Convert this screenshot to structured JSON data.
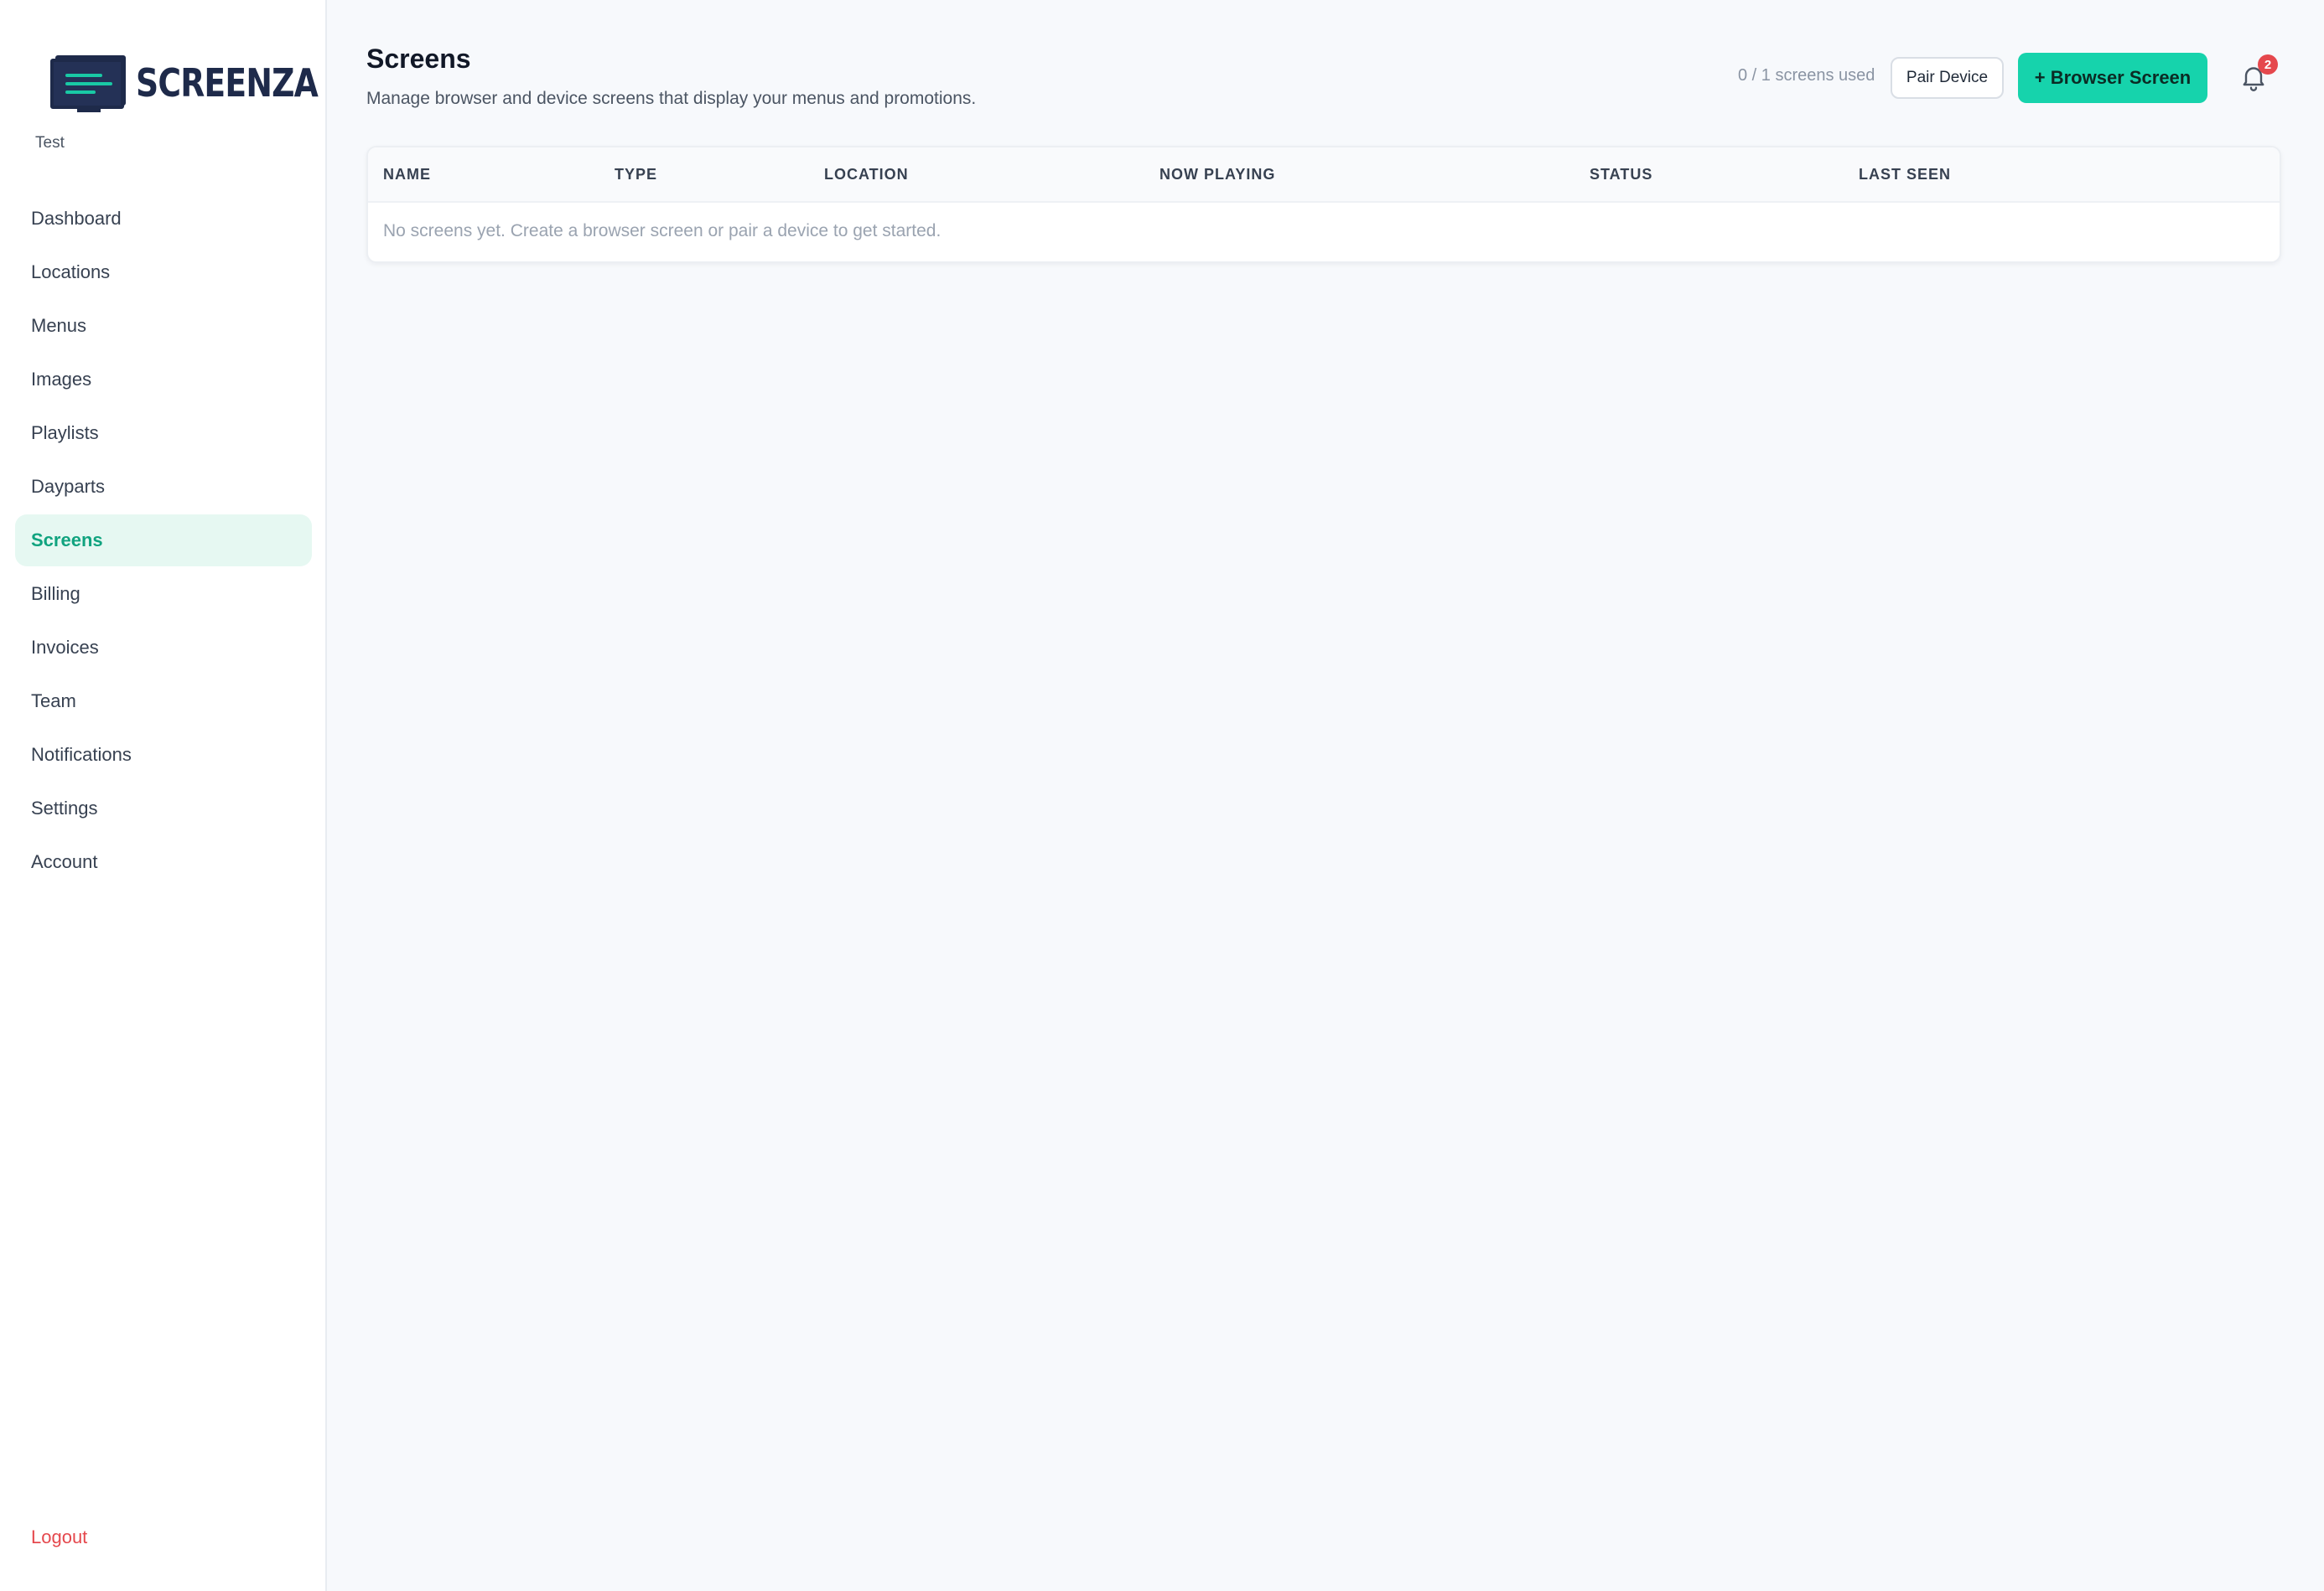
{
  "brand": {
    "logo_text": "SCREENZA",
    "workspace": "Test",
    "accent_color": "#16d3ac",
    "navy_color": "#1e2a4a"
  },
  "sidebar": {
    "items": [
      {
        "label": "Dashboard",
        "active": false
      },
      {
        "label": "Locations",
        "active": false
      },
      {
        "label": "Menus",
        "active": false
      },
      {
        "label": "Images",
        "active": false
      },
      {
        "label": "Playlists",
        "active": false
      },
      {
        "label": "Dayparts",
        "active": false
      },
      {
        "label": "Screens",
        "active": true
      },
      {
        "label": "Billing",
        "active": false
      },
      {
        "label": "Invoices",
        "active": false
      },
      {
        "label": "Team",
        "active": false
      },
      {
        "label": "Notifications",
        "active": false
      },
      {
        "label": "Settings",
        "active": false
      },
      {
        "label": "Account",
        "active": false
      }
    ],
    "logout_label": "Logout"
  },
  "header": {
    "title": "Screens",
    "subtitle": "Manage browser and device screens that display your menus and promotions.",
    "usage": "0 / 1 screens used",
    "pair_label": "Pair Device",
    "browser_label": "+ Browser Screen",
    "notification_count": "2",
    "bell_icon": "bell-icon"
  },
  "table": {
    "columns": [
      "NAME",
      "TYPE",
      "LOCATION",
      "NOW PLAYING",
      "STATUS",
      "LAST SEEN"
    ],
    "empty_message": "No screens yet. Create a browser screen or pair a device to get started."
  }
}
